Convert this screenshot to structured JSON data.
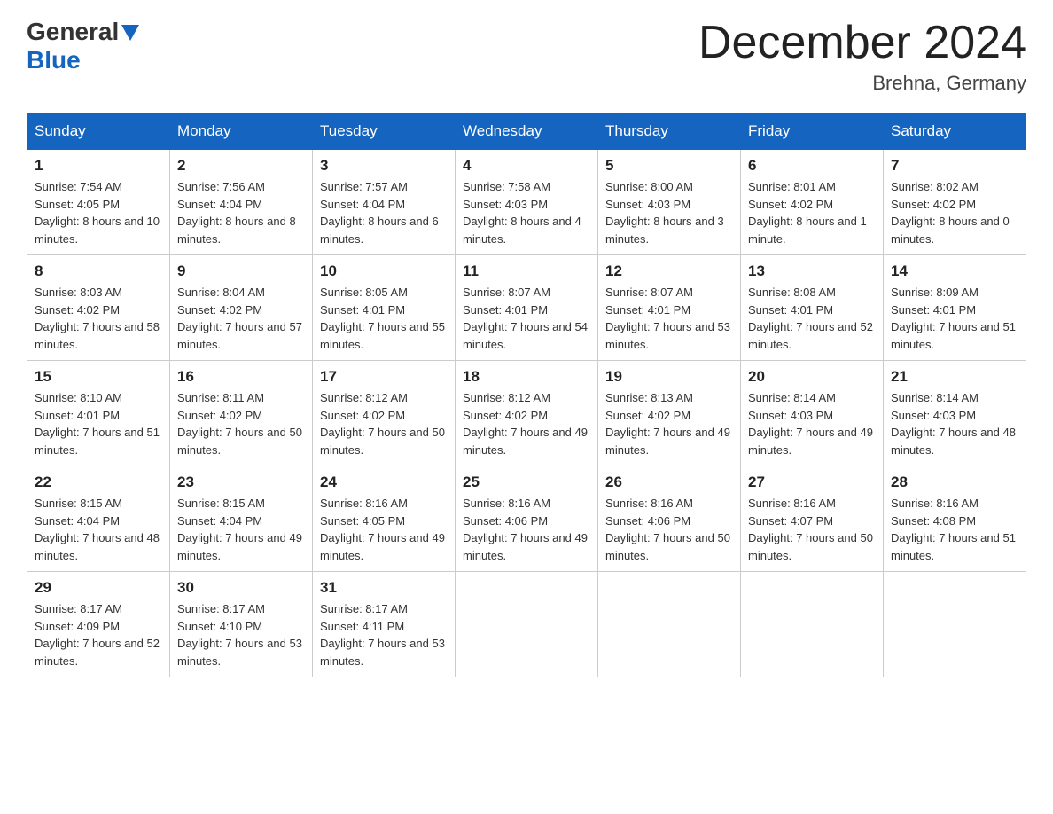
{
  "header": {
    "logo_line1": "General",
    "logo_line2": "Blue",
    "month": "December 2024",
    "location": "Brehna, Germany"
  },
  "days_of_week": [
    "Sunday",
    "Monday",
    "Tuesday",
    "Wednesday",
    "Thursday",
    "Friday",
    "Saturday"
  ],
  "weeks": [
    [
      {
        "day": "1",
        "sunrise": "7:54 AM",
        "sunset": "4:05 PM",
        "daylight": "8 hours and 10 minutes."
      },
      {
        "day": "2",
        "sunrise": "7:56 AM",
        "sunset": "4:04 PM",
        "daylight": "8 hours and 8 minutes."
      },
      {
        "day": "3",
        "sunrise": "7:57 AM",
        "sunset": "4:04 PM",
        "daylight": "8 hours and 6 minutes."
      },
      {
        "day": "4",
        "sunrise": "7:58 AM",
        "sunset": "4:03 PM",
        "daylight": "8 hours and 4 minutes."
      },
      {
        "day": "5",
        "sunrise": "8:00 AM",
        "sunset": "4:03 PM",
        "daylight": "8 hours and 3 minutes."
      },
      {
        "day": "6",
        "sunrise": "8:01 AM",
        "sunset": "4:02 PM",
        "daylight": "8 hours and 1 minute."
      },
      {
        "day": "7",
        "sunrise": "8:02 AM",
        "sunset": "4:02 PM",
        "daylight": "8 hours and 0 minutes."
      }
    ],
    [
      {
        "day": "8",
        "sunrise": "8:03 AM",
        "sunset": "4:02 PM",
        "daylight": "7 hours and 58 minutes."
      },
      {
        "day": "9",
        "sunrise": "8:04 AM",
        "sunset": "4:02 PM",
        "daylight": "7 hours and 57 minutes."
      },
      {
        "day": "10",
        "sunrise": "8:05 AM",
        "sunset": "4:01 PM",
        "daylight": "7 hours and 55 minutes."
      },
      {
        "day": "11",
        "sunrise": "8:07 AM",
        "sunset": "4:01 PM",
        "daylight": "7 hours and 54 minutes."
      },
      {
        "day": "12",
        "sunrise": "8:07 AM",
        "sunset": "4:01 PM",
        "daylight": "7 hours and 53 minutes."
      },
      {
        "day": "13",
        "sunrise": "8:08 AM",
        "sunset": "4:01 PM",
        "daylight": "7 hours and 52 minutes."
      },
      {
        "day": "14",
        "sunrise": "8:09 AM",
        "sunset": "4:01 PM",
        "daylight": "7 hours and 51 minutes."
      }
    ],
    [
      {
        "day": "15",
        "sunrise": "8:10 AM",
        "sunset": "4:01 PM",
        "daylight": "7 hours and 51 minutes."
      },
      {
        "day": "16",
        "sunrise": "8:11 AM",
        "sunset": "4:02 PM",
        "daylight": "7 hours and 50 minutes."
      },
      {
        "day": "17",
        "sunrise": "8:12 AM",
        "sunset": "4:02 PM",
        "daylight": "7 hours and 50 minutes."
      },
      {
        "day": "18",
        "sunrise": "8:12 AM",
        "sunset": "4:02 PM",
        "daylight": "7 hours and 49 minutes."
      },
      {
        "day": "19",
        "sunrise": "8:13 AM",
        "sunset": "4:02 PM",
        "daylight": "7 hours and 49 minutes."
      },
      {
        "day": "20",
        "sunrise": "8:14 AM",
        "sunset": "4:03 PM",
        "daylight": "7 hours and 49 minutes."
      },
      {
        "day": "21",
        "sunrise": "8:14 AM",
        "sunset": "4:03 PM",
        "daylight": "7 hours and 48 minutes."
      }
    ],
    [
      {
        "day": "22",
        "sunrise": "8:15 AM",
        "sunset": "4:04 PM",
        "daylight": "7 hours and 48 minutes."
      },
      {
        "day": "23",
        "sunrise": "8:15 AM",
        "sunset": "4:04 PM",
        "daylight": "7 hours and 49 minutes."
      },
      {
        "day": "24",
        "sunrise": "8:16 AM",
        "sunset": "4:05 PM",
        "daylight": "7 hours and 49 minutes."
      },
      {
        "day": "25",
        "sunrise": "8:16 AM",
        "sunset": "4:06 PM",
        "daylight": "7 hours and 49 minutes."
      },
      {
        "day": "26",
        "sunrise": "8:16 AM",
        "sunset": "4:06 PM",
        "daylight": "7 hours and 50 minutes."
      },
      {
        "day": "27",
        "sunrise": "8:16 AM",
        "sunset": "4:07 PM",
        "daylight": "7 hours and 50 minutes."
      },
      {
        "day": "28",
        "sunrise": "8:16 AM",
        "sunset": "4:08 PM",
        "daylight": "7 hours and 51 minutes."
      }
    ],
    [
      {
        "day": "29",
        "sunrise": "8:17 AM",
        "sunset": "4:09 PM",
        "daylight": "7 hours and 52 minutes."
      },
      {
        "day": "30",
        "sunrise": "8:17 AM",
        "sunset": "4:10 PM",
        "daylight": "7 hours and 53 minutes."
      },
      {
        "day": "31",
        "sunrise": "8:17 AM",
        "sunset": "4:11 PM",
        "daylight": "7 hours and 53 minutes."
      },
      null,
      null,
      null,
      null
    ]
  ]
}
